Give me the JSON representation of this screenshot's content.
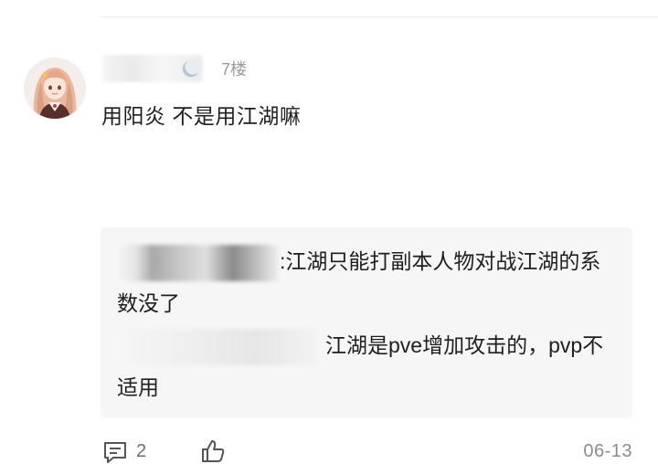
{
  "post": {
    "floor": "7楼",
    "text": "用阳炎 不是用江湖嘛",
    "avatar_icon": "anime-girl-avatar",
    "level_icon": "moon-badge-icon"
  },
  "replies": [
    {
      "text": ":江湖只能打副本人物对战江湖的系数没了"
    },
    {
      "text": "江湖是pve增加攻击的，pvp不适用"
    }
  ],
  "footer": {
    "comment_icon": "comment-icon",
    "comment_count": "2",
    "like_icon": "thumbs-up-icon",
    "date": "06-13"
  },
  "colors": {
    "reply_background": "#f6f6f6",
    "secondary_text": "#9a9a9a"
  }
}
